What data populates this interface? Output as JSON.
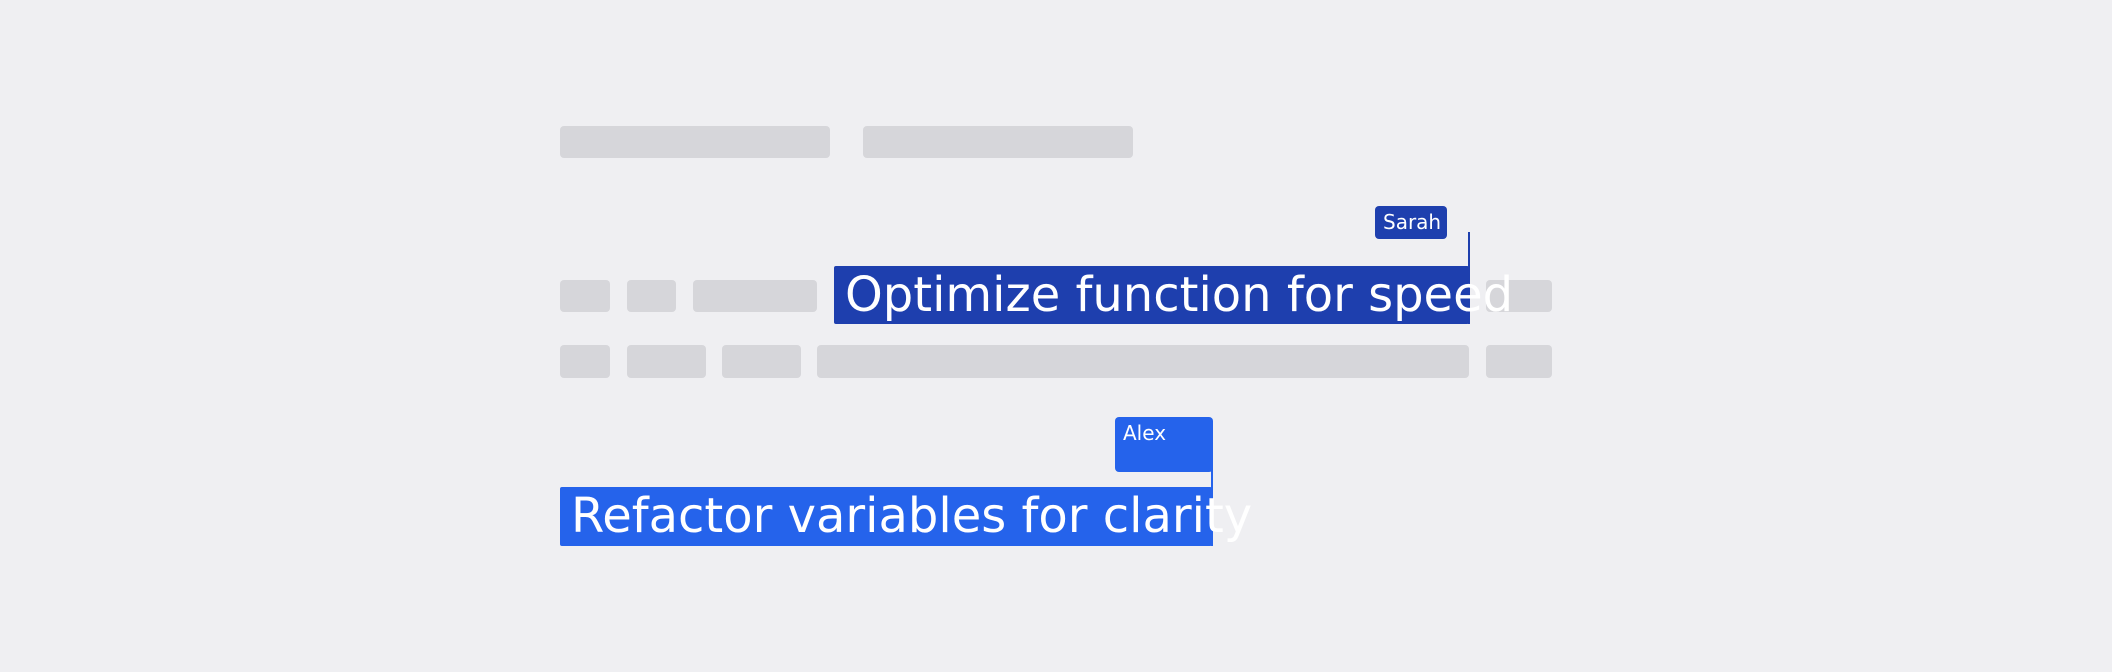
{
  "collaborators": {
    "sarah": {
      "name": "Sarah",
      "selected_text": "Optimize function for speed",
      "color": "#1e3fae"
    },
    "alex": {
      "name": "Alex",
      "selected_text": "Refactor variables for clarity",
      "color": "#2563eb"
    }
  },
  "colors": {
    "background": "#efeff2",
    "placeholder": "#d6d6da"
  }
}
